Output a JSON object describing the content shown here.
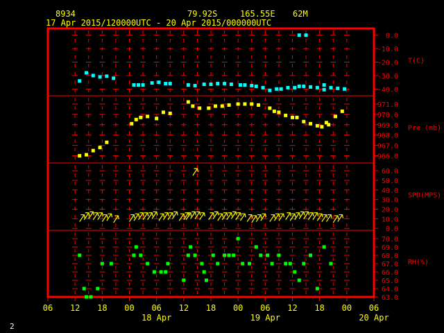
{
  "header": {
    "station": "8934",
    "lat": "79.92S",
    "lon": "165.55E",
    "elev": "62M",
    "time_range": "17 Apr 2015/120000UTC - 20 Apr 2015/000000UTC"
  },
  "corner_label": "2",
  "colors": {
    "frame": "#ff0000",
    "text": "#ffff00",
    "temp": "#00ffff",
    "pres": "#ffff00",
    "wind": "#ffff00",
    "rh": "#00ff00",
    "corner": "#ffffff"
  },
  "chart_data": {
    "type": "scatter",
    "x_axis": {
      "ticks": [
        {
          "h": 6,
          "label": "06"
        },
        {
          "h": 12,
          "label": "12"
        },
        {
          "h": 18,
          "label": "18"
        },
        {
          "h": 24,
          "label": "00"
        },
        {
          "h": 30,
          "label": "06"
        },
        {
          "h": 36,
          "label": "12"
        },
        {
          "h": 42,
          "label": "18"
        },
        {
          "h": 48,
          "label": "00"
        },
        {
          "h": 54,
          "label": "06"
        },
        {
          "h": 60,
          "label": "12"
        },
        {
          "h": 66,
          "label": "18"
        },
        {
          "h": 72,
          "label": "00"
        },
        {
          "h": 78,
          "label": "06"
        }
      ],
      "dates": [
        {
          "h": 30,
          "label": "18 Apr"
        },
        {
          "h": 54,
          "label": "19 Apr"
        },
        {
          "h": 78,
          "label": "20 Apr"
        }
      ],
      "range_hours_from_17Apr00UTC": [
        6,
        78
      ],
      "grid_hours": [
        12,
        15,
        18,
        21,
        24,
        27,
        30,
        33,
        36,
        39,
        42,
        45,
        48,
        51,
        54,
        57,
        60,
        63,
        66,
        69,
        72
      ]
    },
    "panels": [
      {
        "key": "temp",
        "label": "T(C)",
        "ylim": [
          -45,
          5
        ],
        "ticks": [
          {
            "v": 0,
            "label": "0.0"
          },
          {
            "v": -10,
            "label": "-10.0"
          },
          {
            "v": -20,
            "label": "-20.0"
          },
          {
            "v": -30,
            "label": "-30.0"
          },
          {
            "v": -40,
            "label": "-40.0"
          }
        ],
        "points": [
          [
            13,
            -34
          ],
          [
            14.5,
            -28
          ],
          [
            16,
            -30
          ],
          [
            17.5,
            -31
          ],
          [
            19,
            -30.5
          ],
          [
            20.5,
            -32
          ],
          [
            25,
            -37
          ],
          [
            26,
            -37
          ],
          [
            27,
            -37
          ],
          [
            29,
            -35.5
          ],
          [
            30.5,
            -35
          ],
          [
            32,
            -36
          ],
          [
            33,
            -36
          ],
          [
            37,
            -37
          ],
          [
            38.5,
            -37.5
          ],
          [
            40.5,
            -36.5
          ],
          [
            42,
            -36.5
          ],
          [
            43.5,
            -36
          ],
          [
            45,
            -36
          ],
          [
            46.5,
            -36.5
          ],
          [
            48.5,
            -37
          ],
          [
            49.5,
            -37
          ],
          [
            51,
            -37.5
          ],
          [
            52,
            -38
          ],
          [
            53.5,
            -39
          ],
          [
            55,
            -41
          ],
          [
            56.5,
            -40
          ],
          [
            57.5,
            -40
          ],
          [
            59,
            -39
          ],
          [
            60.5,
            -39
          ],
          [
            61.5,
            -38
          ],
          [
            62.5,
            -38
          ],
          [
            64,
            -38.5
          ],
          [
            65.5,
            -39
          ],
          [
            67,
            -40.5
          ],
          [
            67,
            -37
          ],
          [
            68.5,
            -39
          ],
          [
            70,
            -39.5
          ],
          [
            71.5,
            -40
          ],
          [
            61.5,
            0
          ],
          [
            63,
            0
          ]
        ]
      },
      {
        "key": "pres",
        "label": "Pre (mb)",
        "ylim": [
          965.3,
          971.8
        ],
        "ticks": [
          {
            "v": 971,
            "label": "971.0"
          },
          {
            "v": 970,
            "label": "970.0"
          },
          {
            "v": 969,
            "label": "969.0"
          },
          {
            "v": 968,
            "label": "968.0"
          },
          {
            "v": 967,
            "label": "967.0"
          },
          {
            "v": 966,
            "label": "966.0"
          }
        ],
        "points": [
          [
            13,
            966
          ],
          [
            14.5,
            966.1
          ],
          [
            16,
            966.5
          ],
          [
            17.5,
            966.8
          ],
          [
            19,
            967.3
          ],
          [
            24.5,
            969.1
          ],
          [
            25.5,
            969.5
          ],
          [
            26.5,
            969.7
          ],
          [
            28,
            969.8
          ],
          [
            30,
            969.6
          ],
          [
            31.5,
            970.2
          ],
          [
            33,
            970.1
          ],
          [
            37,
            971.2
          ],
          [
            38,
            970.8
          ],
          [
            39.5,
            970.6
          ],
          [
            41.5,
            970.6
          ],
          [
            43,
            970.8
          ],
          [
            44.5,
            970.8
          ],
          [
            46,
            970.9
          ],
          [
            48,
            971
          ],
          [
            49.5,
            971
          ],
          [
            51,
            971
          ],
          [
            52.5,
            970.9
          ],
          [
            55,
            970.6
          ],
          [
            56,
            970.3
          ],
          [
            57,
            970.2
          ],
          [
            58.5,
            969.9
          ],
          [
            60,
            969.7
          ],
          [
            61,
            969.7
          ],
          [
            62.5,
            969.3
          ],
          [
            64,
            969.1
          ],
          [
            65.5,
            968.9
          ],
          [
            66.5,
            968.8
          ],
          [
            67.5,
            969.2
          ],
          [
            68,
            969
          ],
          [
            69.5,
            969.8
          ],
          [
            71,
            970.3
          ]
        ]
      },
      {
        "key": "wind",
        "label": "SPD(MPS)",
        "ylim": [
          -2,
          68
        ],
        "ticks": [
          {
            "v": 60,
            "label": "60.0"
          },
          {
            "v": 50,
            "label": "50.0"
          },
          {
            "v": 40,
            "label": "40.0"
          },
          {
            "v": 30,
            "label": "30.0"
          },
          {
            "v": 20,
            "label": "20.0"
          },
          {
            "v": 10,
            "label": "10.0"
          },
          {
            "v": 0,
            "label": "0.0"
          }
        ],
        "points": [
          [
            13,
            7
          ],
          [
            14,
            9
          ],
          [
            15,
            10
          ],
          [
            16,
            9
          ],
          [
            17,
            9
          ],
          [
            18,
            7
          ],
          [
            19,
            8
          ],
          [
            20.5,
            6
          ],
          [
            24,
            7
          ],
          [
            25,
            8
          ],
          [
            26,
            9
          ],
          [
            27,
            9
          ],
          [
            28,
            9
          ],
          [
            29,
            10
          ],
          [
            30.5,
            8
          ],
          [
            31.5,
            9
          ],
          [
            32.5,
            9
          ],
          [
            33.5,
            10
          ],
          [
            35,
            8
          ],
          [
            36,
            9
          ],
          [
            36.5,
            9
          ],
          [
            37.5,
            10
          ],
          [
            38.5,
            10
          ],
          [
            39.5,
            9
          ],
          [
            41.5,
            9
          ],
          [
            42.5,
            10
          ],
          [
            43.5,
            8
          ],
          [
            44.5,
            9
          ],
          [
            45.5,
            9
          ],
          [
            46.5,
            10
          ],
          [
            47.5,
            9
          ],
          [
            48.5,
            8
          ],
          [
            50,
            7
          ],
          [
            51,
            6
          ],
          [
            52,
            7
          ],
          [
            53,
            8
          ],
          [
            55,
            7
          ],
          [
            56,
            8
          ],
          [
            57,
            8
          ],
          [
            58.5,
            9
          ],
          [
            59.5,
            8
          ],
          [
            60.5,
            9
          ],
          [
            61.5,
            10
          ],
          [
            62.5,
            10
          ],
          [
            63.5,
            9
          ],
          [
            64.5,
            9
          ],
          [
            65.5,
            8
          ],
          [
            66.5,
            7
          ],
          [
            67.5,
            7
          ],
          [
            69,
            6
          ],
          [
            70,
            7
          ],
          [
            38,
            55
          ]
        ]
      },
      {
        "key": "rh",
        "label": "RH(%)",
        "ylim": [
          63,
          71
        ],
        "ticks": [
          {
            "v": 70,
            "label": "70.0"
          },
          {
            "v": 69,
            "label": "69.0"
          },
          {
            "v": 68,
            "label": "68.0"
          },
          {
            "v": 67,
            "label": "67.0"
          },
          {
            "v": 66,
            "label": "66.0"
          },
          {
            "v": 65,
            "label": "65.0"
          },
          {
            "v": 64,
            "label": "64.0"
          },
          {
            "v": 63,
            "label": "63.0"
          }
        ],
        "points": [
          [
            13,
            68
          ],
          [
            14,
            64
          ],
          [
            14.5,
            63
          ],
          [
            15.5,
            63
          ],
          [
            17,
            64
          ],
          [
            18,
            67
          ],
          [
            20,
            67
          ],
          [
            25,
            68
          ],
          [
            25.5,
            69
          ],
          [
            26.5,
            68
          ],
          [
            28,
            67
          ],
          [
            29.5,
            66
          ],
          [
            31,
            66
          ],
          [
            32,
            66
          ],
          [
            32.5,
            67
          ],
          [
            36,
            65
          ],
          [
            37,
            68
          ],
          [
            37.5,
            69
          ],
          [
            38.5,
            68
          ],
          [
            40,
            67
          ],
          [
            40.5,
            66
          ],
          [
            41,
            65
          ],
          [
            42.5,
            68
          ],
          [
            43.5,
            67
          ],
          [
            45,
            68
          ],
          [
            46,
            68
          ],
          [
            47,
            68
          ],
          [
            48,
            70
          ],
          [
            49,
            67
          ],
          [
            50.5,
            67
          ],
          [
            52,
            69
          ],
          [
            53,
            68
          ],
          [
            54.5,
            68
          ],
          [
            55.5,
            67
          ],
          [
            57,
            68
          ],
          [
            58.5,
            67
          ],
          [
            59.5,
            67
          ],
          [
            60.5,
            66
          ],
          [
            61.5,
            65
          ],
          [
            62.5,
            67
          ],
          [
            64,
            68
          ],
          [
            65.5,
            64
          ],
          [
            67,
            69
          ],
          [
            68.5,
            67
          ]
        ]
      }
    ]
  }
}
